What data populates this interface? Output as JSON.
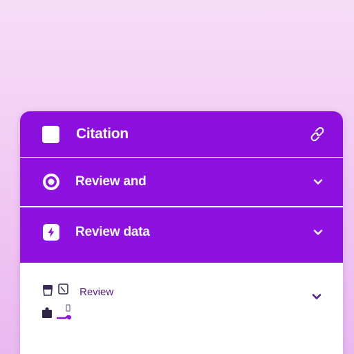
{
  "panel": {
    "header": {
      "title": "Citation",
      "action_icon": "link-icon"
    },
    "rows": [
      {
        "label": "Review and",
        "icon": "target-icon",
        "expanded": false
      },
      {
        "label": "Review data",
        "icon": "bolt-icon",
        "expanded": false
      }
    ],
    "expanded_section": {
      "label": "Review",
      "icons": [
        "mug-icon",
        "note-icon",
        "puzzle-icon",
        "bottle-icon"
      ],
      "expanded": true
    }
  },
  "colors": {
    "accent": "#8b10de",
    "background": "#f1ccf3",
    "surface": "#ffffff",
    "text_on_accent": "#ffffff",
    "text_muted": "#5a1a8c"
  }
}
